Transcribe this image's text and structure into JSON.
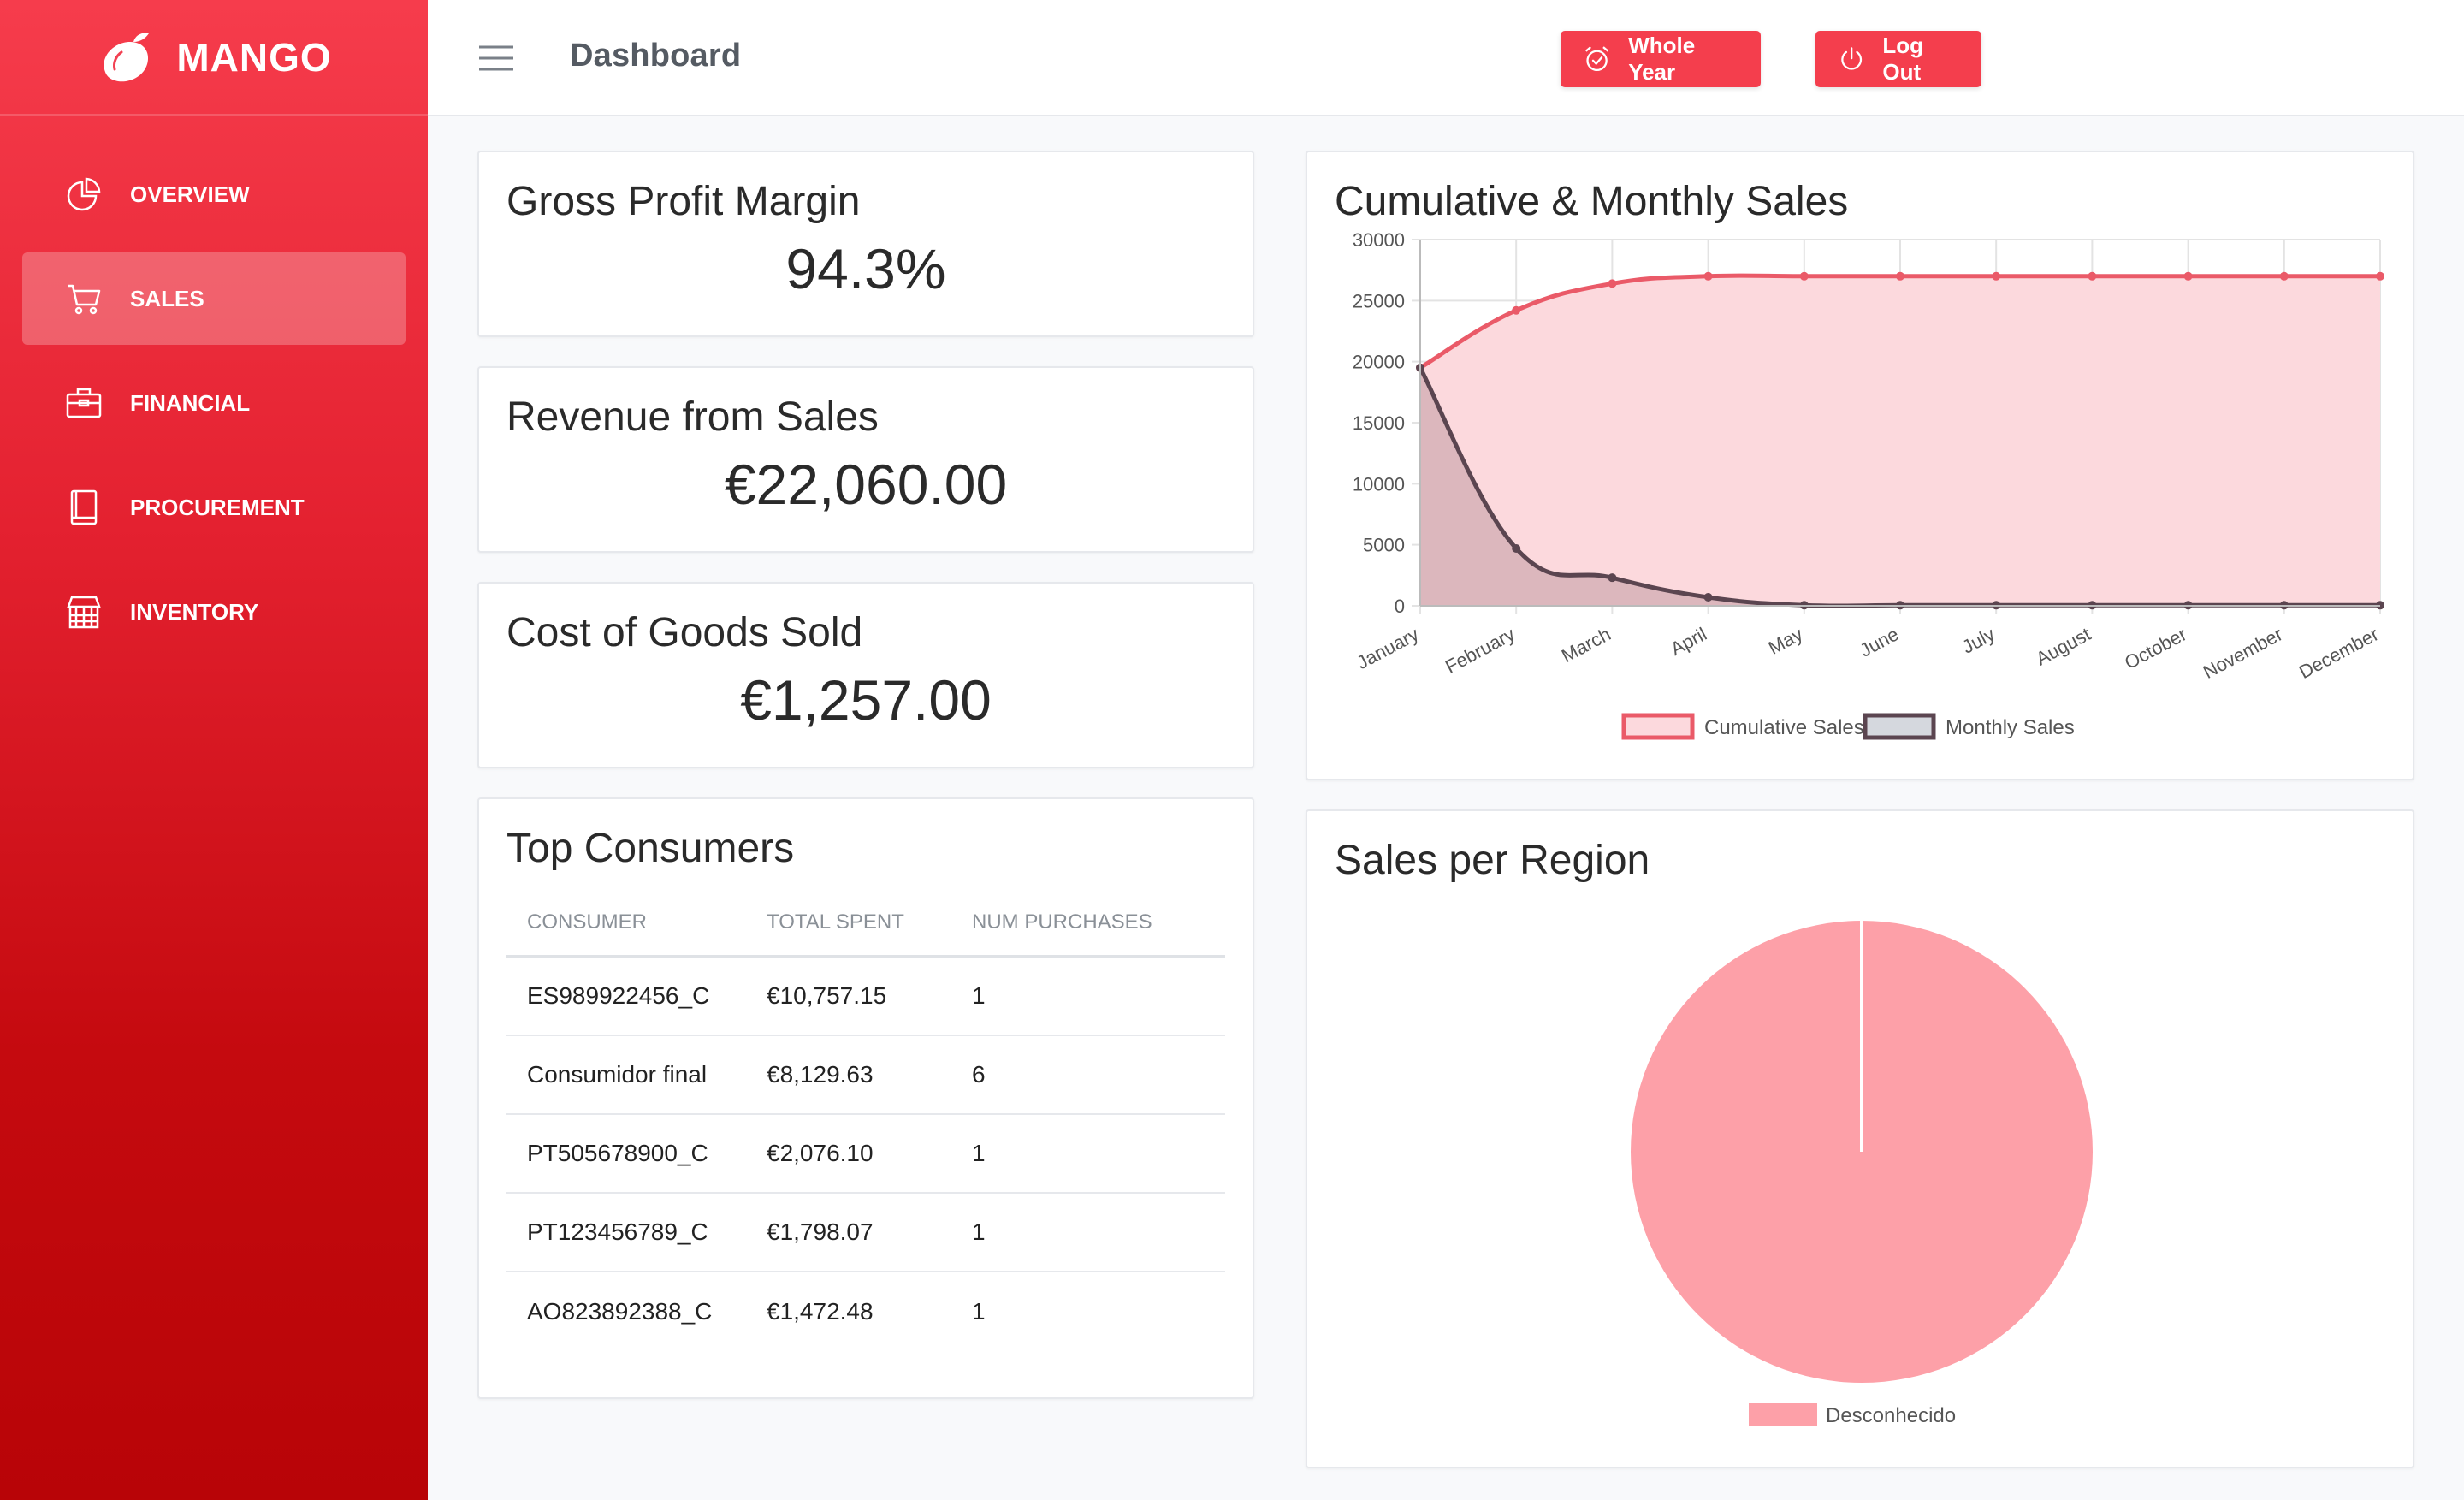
{
  "brand": {
    "name": "MANGO"
  },
  "sidebar": {
    "items": [
      {
        "label": "OVERVIEW",
        "icon": "pie-chart-icon",
        "active": false
      },
      {
        "label": "SALES",
        "icon": "cart-icon",
        "active": true
      },
      {
        "label": "FINANCIAL",
        "icon": "briefcase-icon",
        "active": false
      },
      {
        "label": "PROCUREMENT",
        "icon": "book-icon",
        "active": false
      },
      {
        "label": "INVENTORY",
        "icon": "store-icon",
        "active": false
      }
    ]
  },
  "header": {
    "title": "Dashboard",
    "period_button": "Whole Year",
    "logout_button": "Log Out"
  },
  "kpis": {
    "gross_profit": {
      "title": "Gross Profit Margin",
      "value": "94.3%"
    },
    "revenue": {
      "title": "Revenue from Sales",
      "value": "€22,060.00"
    },
    "cogs": {
      "title": "Cost of Goods Sold",
      "value": "€1,257.00"
    }
  },
  "top_consumers": {
    "title": "Top Consumers",
    "columns": [
      "CONSUMER",
      "TOTAL SPENT",
      "NUM PURCHASES"
    ],
    "rows": [
      [
        "ES989922456_C",
        "€10,757.15",
        "1"
      ],
      [
        "Consumidor final",
        "€8,129.63",
        "6"
      ],
      [
        "PT505678900_C",
        "€2,076.10",
        "1"
      ],
      [
        "PT123456789_C",
        "€1,798.07",
        "1"
      ],
      [
        "AO823892388_C",
        "€1,472.48",
        "1"
      ]
    ]
  },
  "colors": {
    "accent": "#f43e4d",
    "cumulative_line": "#ea5a68",
    "cumulative_fill": "#fcd9dd",
    "monthly_line": "#5b4550",
    "pie_fill": "#fda0a8"
  },
  "chart_data": [
    {
      "type": "area",
      "title": "Cumulative & Monthly Sales",
      "categories": [
        "January",
        "February",
        "March",
        "April",
        "May",
        "June",
        "July",
        "August",
        "October",
        "November",
        "December"
      ],
      "series": [
        {
          "name": "Cumulative Sales",
          "values": [
            19500,
            24200,
            26400,
            27000,
            27000,
            27000,
            27000,
            27000,
            27000,
            27000,
            27000
          ]
        },
        {
          "name": "Monthly Sales",
          "values": [
            19500,
            4700,
            2300,
            700,
            50,
            50,
            50,
            50,
            50,
            50,
            50
          ]
        }
      ],
      "ylim": [
        0,
        30000
      ],
      "yticks": [
        0,
        5000,
        10000,
        15000,
        20000,
        25000,
        30000
      ],
      "grid": true,
      "legend": "bottom"
    },
    {
      "type": "pie",
      "title": "Sales per Region",
      "labels": [
        "Desconhecido"
      ],
      "values": [
        100
      ],
      "legend": "bottom"
    }
  ]
}
